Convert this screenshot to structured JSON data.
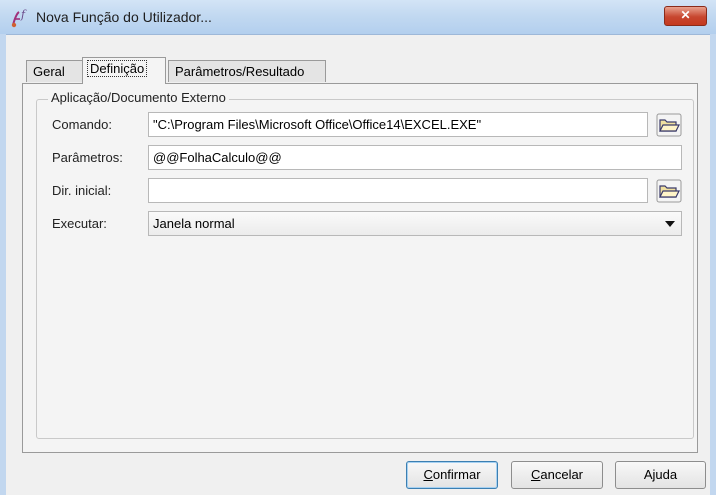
{
  "window": {
    "title": "Nova Função do Utilizador...",
    "close_symbol": "✕"
  },
  "tabs": [
    {
      "label": "Geral",
      "active": false
    },
    {
      "label": "Definição",
      "active": true
    },
    {
      "label": "Parâmetros/Resultado",
      "active": false
    }
  ],
  "group": {
    "legend": "Aplicação/Documento Externo",
    "comando": {
      "label": "Comando:",
      "value": "\"C:\\Program Files\\Microsoft Office\\Office14\\EXCEL.EXE\""
    },
    "parametros": {
      "label": "Parâmetros:",
      "value": "@@FolhaCalculo@@"
    },
    "dir_inicial": {
      "label": "Dir. inicial:",
      "value": ""
    },
    "executar": {
      "label": "Executar:",
      "value": "Janela normal"
    }
  },
  "buttons": {
    "confirmar": {
      "hot": "C",
      "rest": "onfirmar"
    },
    "cancelar": {
      "hot": "C",
      "rest": "ancelar"
    },
    "ajuda": {
      "pre": "A",
      "hot": "j",
      "rest": "uda"
    }
  },
  "colors": {
    "titlebar": "#c2d9f1",
    "close_button": "#c7462f",
    "window_background": "#f0f0f0",
    "default_button_border": "#3c7fb1"
  },
  "icons": {
    "app": "function-icon",
    "browse": "folder-open-icon",
    "dropdown": "chevron-down-icon",
    "close": "close-icon"
  }
}
